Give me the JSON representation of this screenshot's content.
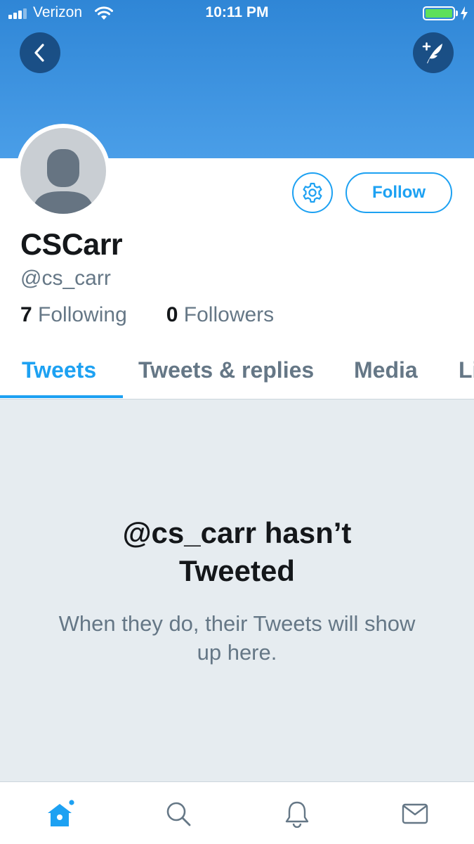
{
  "status_bar": {
    "carrier": "Verizon",
    "time": "10:11 PM",
    "battery_color": "#5ee05a"
  },
  "header": {
    "back_icon": "chevron-left-icon",
    "compose_icon": "compose-tweet-icon",
    "banner_color": "#3b91e0"
  },
  "profile": {
    "display_name": "CSCarr",
    "handle": "@cs_carr",
    "following_count": "7",
    "following_label": "Following",
    "followers_count": "0",
    "followers_label": "Followers",
    "follow_label": "Follow",
    "settings_icon": "gear-icon"
  },
  "tabs": [
    {
      "label": "Tweets",
      "active": true
    },
    {
      "label": "Tweets & replies",
      "active": false
    },
    {
      "label": "Media",
      "active": false
    },
    {
      "label": "Likes",
      "active": false
    }
  ],
  "empty_state": {
    "title": "@cs_carr hasn’t Tweeted",
    "subtitle": "When they do, their Tweets will show up here."
  },
  "bottom_nav": [
    {
      "icon": "home-icon",
      "active": true
    },
    {
      "icon": "search-icon",
      "active": false
    },
    {
      "icon": "notifications-bell-icon",
      "active": false
    },
    {
      "icon": "messages-envelope-icon",
      "active": false
    }
  ],
  "colors": {
    "accent": "#1da1f2",
    "text_primary": "#14171a",
    "text_secondary": "#657786",
    "empty_background": "#e6ecf0"
  }
}
